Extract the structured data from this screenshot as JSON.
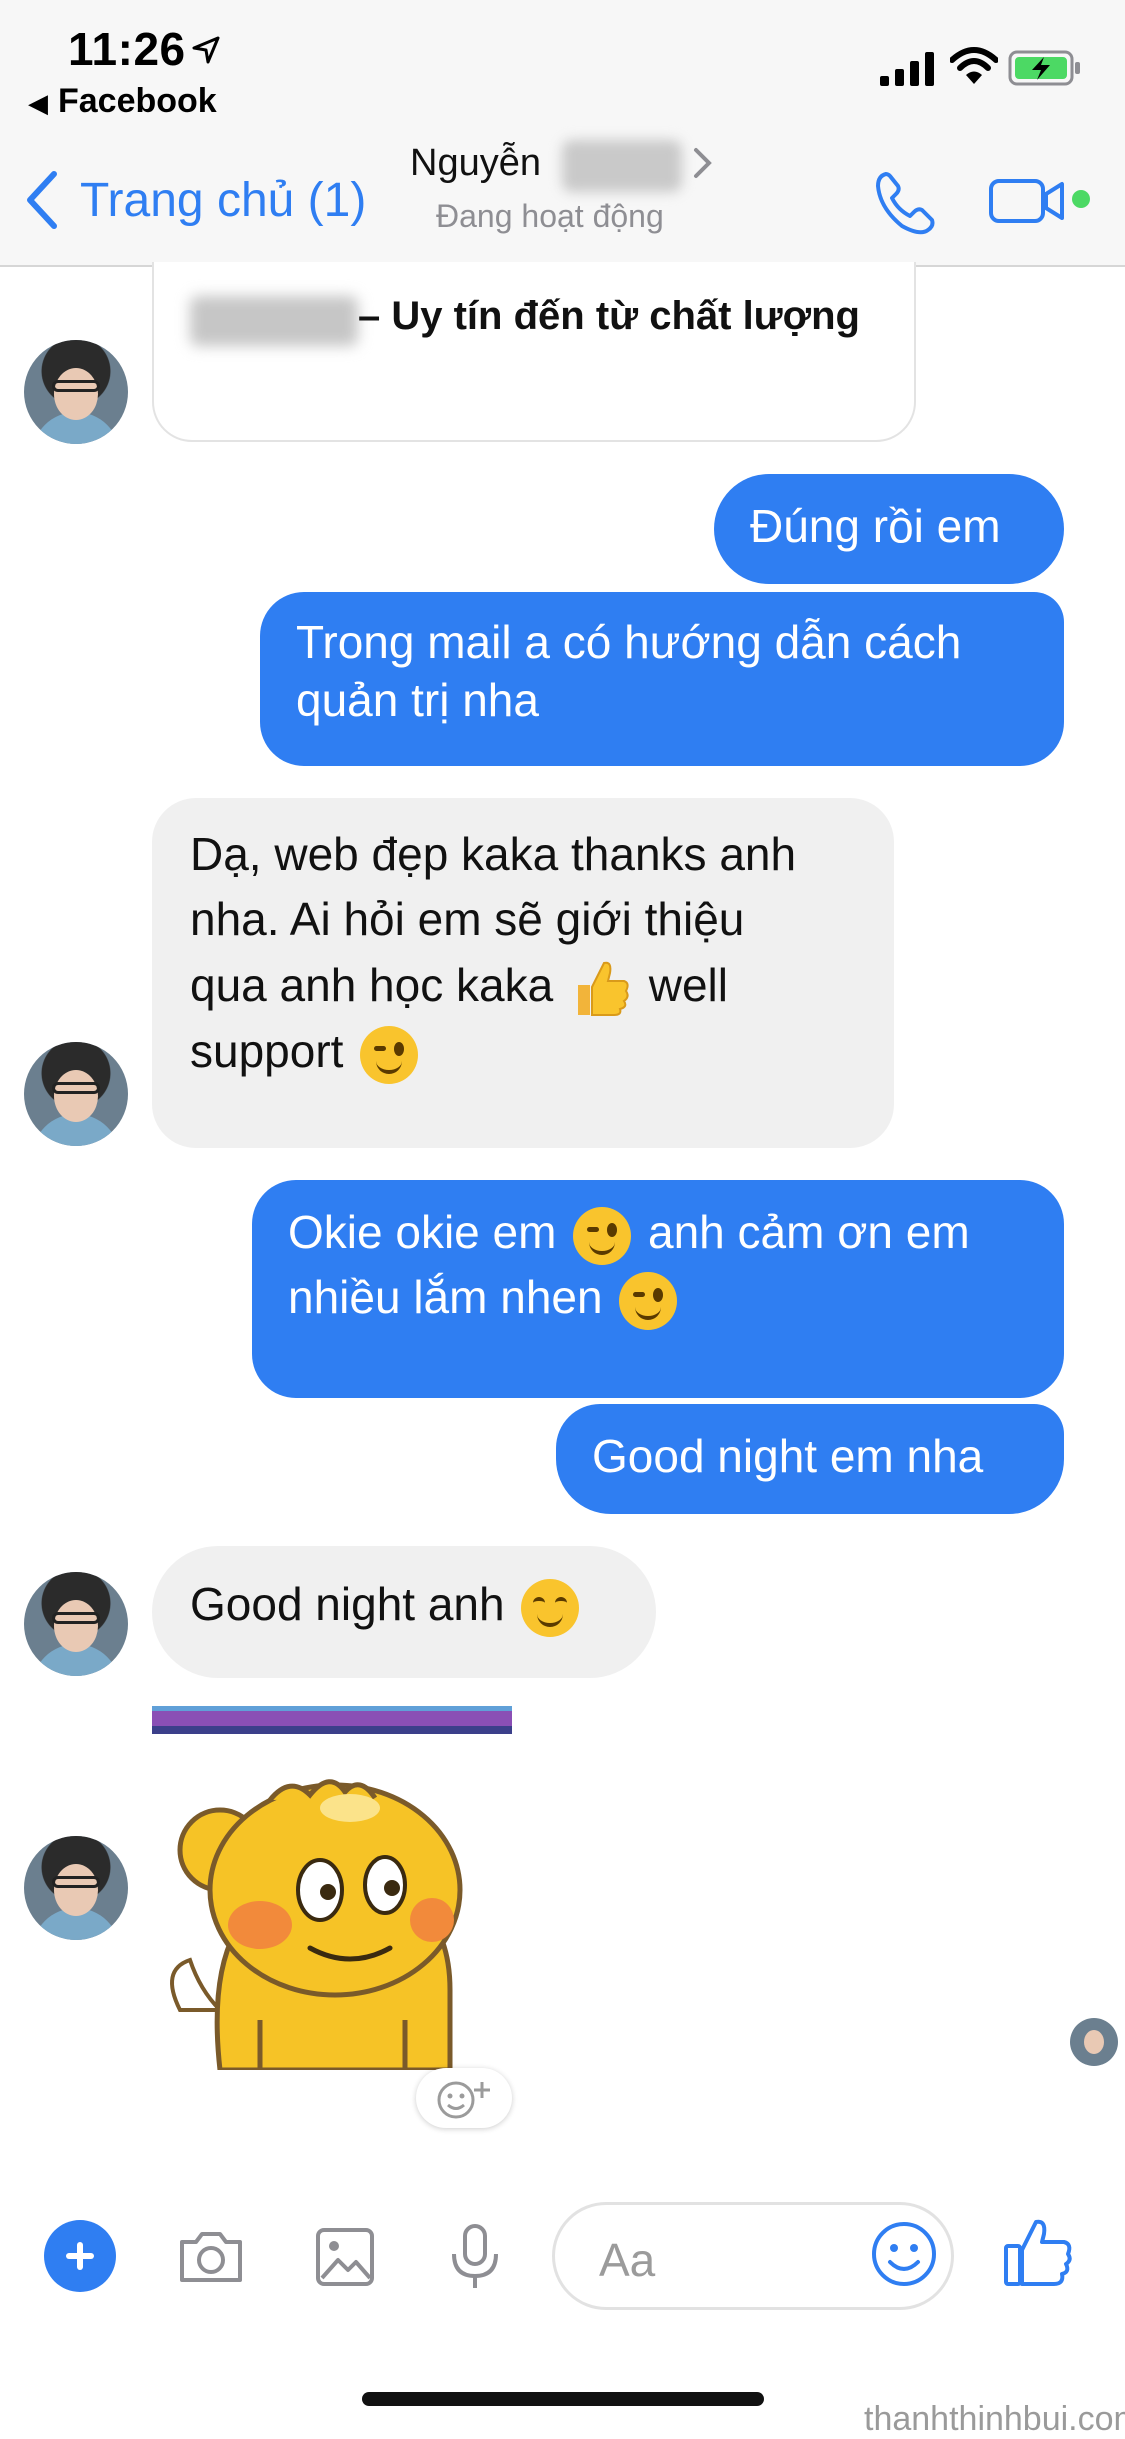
{
  "status_bar": {
    "time": "11:26",
    "back_app": "Facebook"
  },
  "header": {
    "back_label": "Trang chủ (1)",
    "contact_name": "Nguyễn",
    "contact_status": "Đang hoạt động",
    "accent_color": "#2f7ef2",
    "online_color": "#4cd964"
  },
  "messages": [
    {
      "from": "them",
      "type": "link-card",
      "text": "– Uy tín đến từ chất lượng"
    },
    {
      "from": "me",
      "text": "Đúng rồi em"
    },
    {
      "from": "me",
      "lines": [
        "Trong mail a có hướng dẫn cách",
        "quản trị nha"
      ]
    },
    {
      "from": "them",
      "lines": [
        "Dạ, web đẹp kaka thanks anh",
        "nha. Ai hỏi em sẽ giới thiệu",
        "qua anh học kaka",
        "well",
        "support"
      ],
      "icons": [
        "thumbs-up-emoji",
        "wink-emoji"
      ]
    },
    {
      "from": "me",
      "lines": [
        "Okie okie em",
        "anh cảm ơn em",
        "nhiều lắm nhen"
      ],
      "icons": [
        "wink-emoji",
        "wink-emoji"
      ]
    },
    {
      "from": "me",
      "text": "Good night em nha"
    },
    {
      "from": "them",
      "text": "Good night anh",
      "icons": [
        "smile-emoji"
      ]
    },
    {
      "from": "them",
      "type": "sticker",
      "icon": "yellow-chick-sticker"
    }
  ],
  "composer": {
    "placeholder": "Aa",
    "icons": [
      "plus-icon",
      "camera-icon",
      "image-icon",
      "microphone-icon",
      "emoji-icon",
      "thumbs-up-icon"
    ]
  },
  "watermark": "thanhthinhbui.com"
}
